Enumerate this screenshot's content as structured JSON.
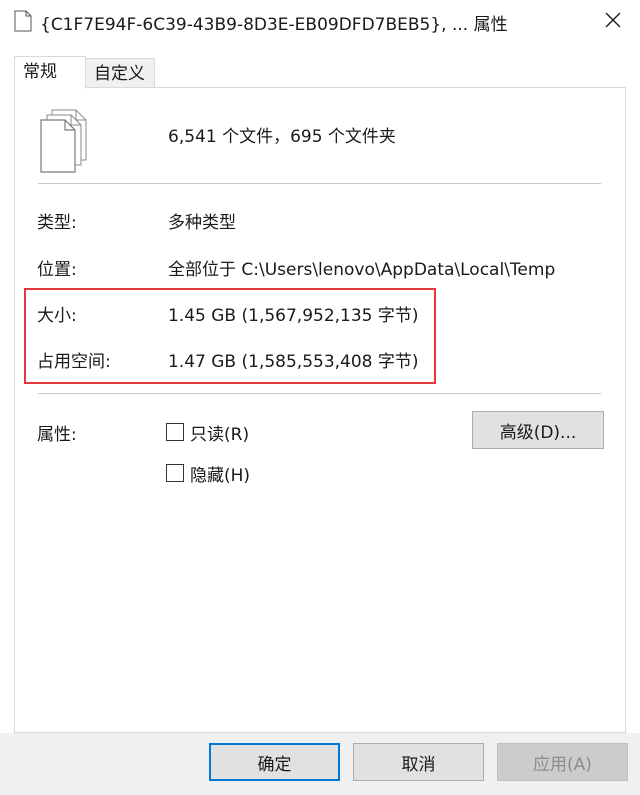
{
  "window": {
    "title": "{C1F7E94F-6C39-43B9-8D3E-EB09DFD7BEB5}, ... 属性",
    "close_glyph": "✕"
  },
  "tabs": [
    {
      "label": "常规",
      "active": true
    },
    {
      "label": "自定义",
      "active": false
    }
  ],
  "summary": {
    "icon": "multiple-files-icon",
    "text": "6,541 个文件，695 个文件夹"
  },
  "properties": {
    "type_label": "类型:",
    "type_value": "多种类型",
    "location_label": "位置:",
    "location_value": "全部位于 C:\\Users\\lenovo\\AppData\\Local\\Temp",
    "size_label": "大小:",
    "size_value": "1.45 GB (1,567,952,135 字节)",
    "size_on_disk_label": "占用空间:",
    "size_on_disk_value": "1.47 GB (1,585,553,408 字节)"
  },
  "attributes": {
    "label": "属性:",
    "readonly": {
      "label": "只读(R)",
      "checked": false
    },
    "hidden": {
      "label": "隐藏(H)",
      "checked": false
    },
    "advanced_button": "高级(D)..."
  },
  "footer": {
    "ok": "确定",
    "cancel": "取消",
    "apply": "应用(A)"
  },
  "colors": {
    "highlight_border": "#e2383a",
    "default_button_border": "#0078d7"
  }
}
